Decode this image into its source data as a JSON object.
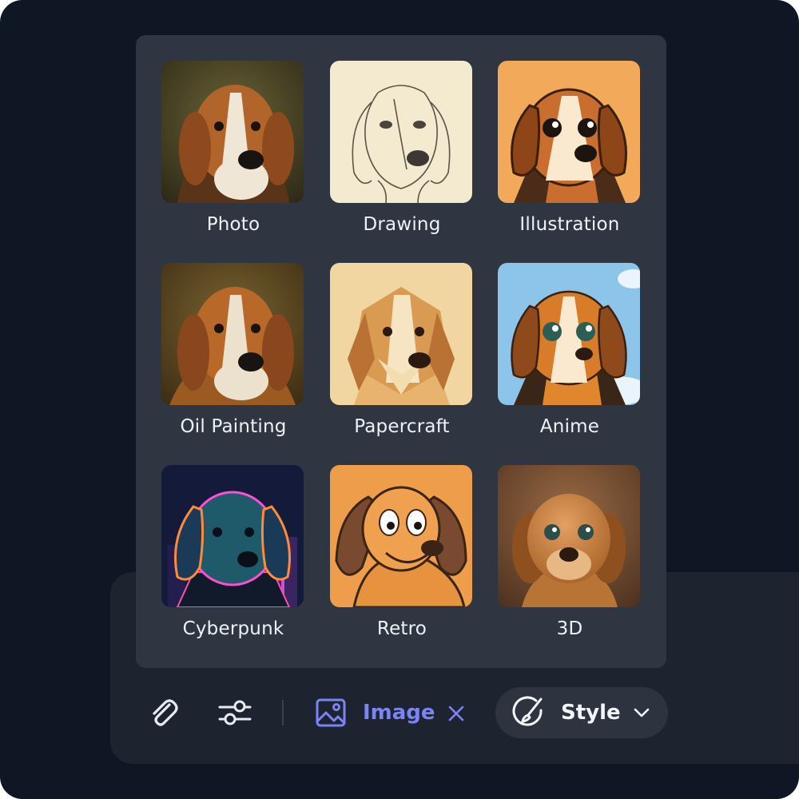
{
  "style_picker": {
    "tiles": [
      {
        "label": "Photo",
        "thumbnail": "beagle-photo"
      },
      {
        "label": "Drawing",
        "thumbnail": "beagle-pencil-drawing"
      },
      {
        "label": "Illustration",
        "thumbnail": "beagle-cartoon-illustration"
      },
      {
        "label": "Oil Painting",
        "thumbnail": "beagle-oil-painting"
      },
      {
        "label": "Papercraft",
        "thumbnail": "beagle-papercraft"
      },
      {
        "label": "Anime",
        "thumbnail": "beagle-anime"
      },
      {
        "label": "Cyberpunk",
        "thumbnail": "beagle-cyberpunk-neon"
      },
      {
        "label": "Retro",
        "thumbnail": "beagle-retro-cartoon"
      },
      {
        "label": "3D",
        "thumbnail": "beagle-3d-render"
      }
    ]
  },
  "toolbar": {
    "attach_icon": "paperclip-icon",
    "settings_icon": "sliders-icon",
    "image_chip": {
      "icon": "image-icon",
      "label": "Image",
      "remove_icon": "close-icon"
    },
    "style_button": {
      "icon": "brush-icon",
      "label": "Style",
      "dropdown_icon": "chevron-down-icon"
    }
  },
  "colors": {
    "background": "#0f1624",
    "popover": "#2f3641",
    "composer": "#1d2430",
    "accent": "#7c83f5",
    "text": "#eef1f5"
  }
}
